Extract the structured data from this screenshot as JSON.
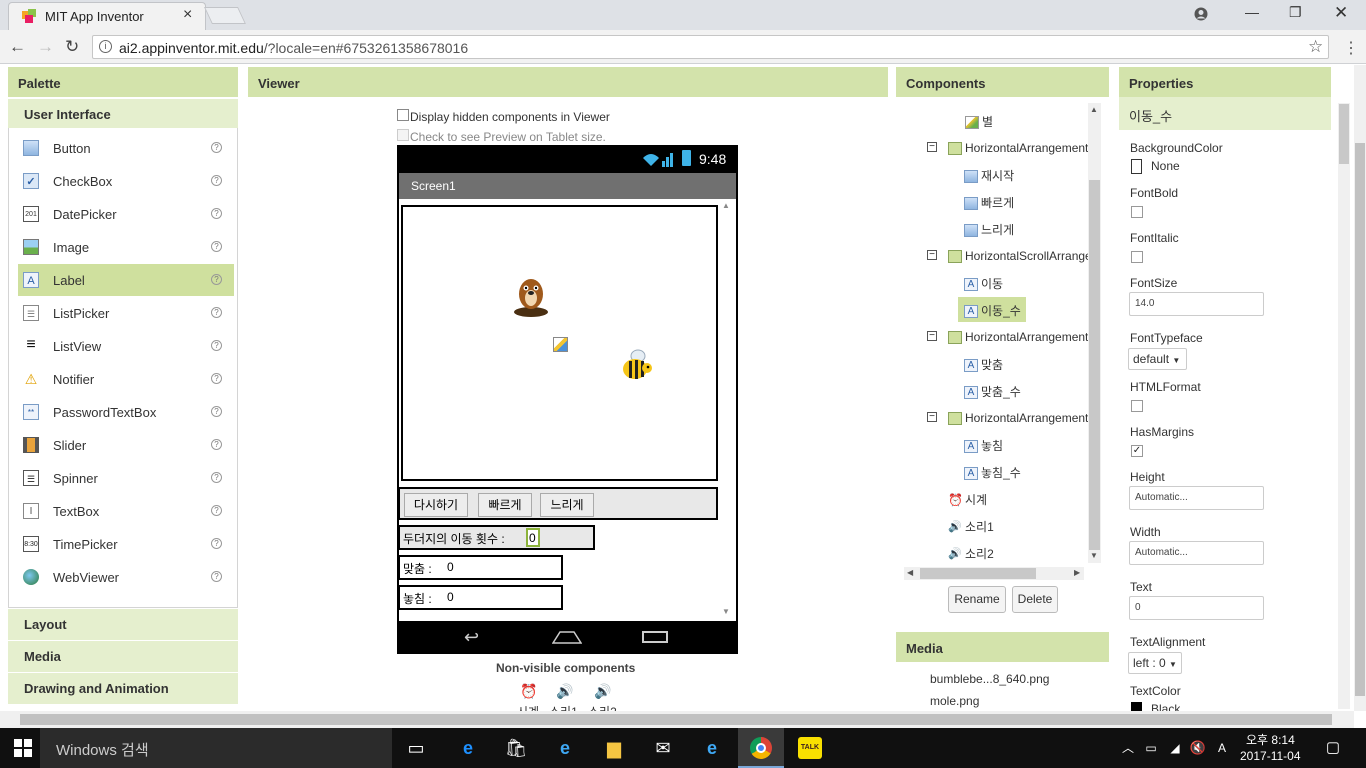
{
  "browser": {
    "tab_title": "MIT App Inventor",
    "url_host": "ai2.appinventor.mit.edu",
    "url_rest": "/?locale=en#6753261358678016"
  },
  "palette": {
    "title": "Palette",
    "active_category": "User Interface",
    "items": [
      "Button",
      "CheckBox",
      "DatePicker",
      "Image",
      "Label",
      "ListPicker",
      "ListView",
      "Notifier",
      "PasswordTextBox",
      "Slider",
      "Spinner",
      "TextBox",
      "TimePicker",
      "WebViewer"
    ],
    "selected": "Label",
    "other_categories": [
      "Layout",
      "Media",
      "Drawing and Animation"
    ]
  },
  "viewer": {
    "title": "Viewer",
    "display_hidden": "Display hidden components in Viewer",
    "tablet_preview": "Check to see Preview on Tablet size.",
    "time": "9:48",
    "screen_title": "Screen1",
    "buttons": [
      "다시하기",
      "빠르게",
      "느리게"
    ],
    "move_label": "두더지의 이동 횟수 :",
    "move_value": "0",
    "hit_label": "맞춤 :",
    "hit_value": "0",
    "miss_label": "놓침 :",
    "miss_value": "0",
    "nonvisible_title": "Non-visible components",
    "nonvisible": [
      "시계",
      "소리1",
      "소리2"
    ]
  },
  "components": {
    "title": "Components",
    "tree": [
      {
        "label": "별",
        "type": "sprite"
      },
      {
        "label": "HorizontalArrangement",
        "type": "arrangement",
        "toggle": "−"
      },
      {
        "label": "재시작",
        "type": "button"
      },
      {
        "label": "빠르게",
        "type": "button"
      },
      {
        "label": "느리게",
        "type": "button"
      },
      {
        "label": "HorizontalScrollArrangement",
        "type": "arrangement",
        "toggle": "−"
      },
      {
        "label": "이동",
        "type": "label"
      },
      {
        "label": "이동_수",
        "type": "label",
        "selected": true
      },
      {
        "label": "HorizontalArrangement",
        "type": "arrangement",
        "toggle": "−"
      },
      {
        "label": "맞춤",
        "type": "label"
      },
      {
        "label": "맞춤_수",
        "type": "label"
      },
      {
        "label": "HorizontalArrangement",
        "type": "arrangement",
        "toggle": "−"
      },
      {
        "label": "놓침",
        "type": "label"
      },
      {
        "label": "놓침_수",
        "type": "label"
      },
      {
        "label": "시계",
        "type": "clock"
      },
      {
        "label": "소리1",
        "type": "sound"
      },
      {
        "label": "소리2",
        "type": "sound"
      }
    ],
    "rename_label": "Rename",
    "delete_label": "Delete"
  },
  "media": {
    "title": "Media",
    "files": [
      "bumblebe...8_640.png",
      "mole.png"
    ]
  },
  "properties": {
    "title": "Properties",
    "component": "이동_수",
    "background_color_label": "BackgroundColor",
    "background_color_value": "None",
    "font_bold_label": "FontBold",
    "font_italic_label": "FontItalic",
    "font_size_label": "FontSize",
    "font_size_value": "14.0",
    "font_typeface_label": "FontTypeface",
    "font_typeface_value": "default",
    "html_format_label": "HTMLFormat",
    "has_margins_label": "HasMargins",
    "height_label": "Height",
    "height_value": "Automatic...",
    "width_label": "Width",
    "width_value": "Automatic...",
    "text_label": "Text",
    "text_value": "0",
    "text_alignment_label": "TextAlignment",
    "text_alignment_value": "left : 0",
    "text_color_label": "TextColor",
    "text_color_value": "Black",
    "has_margins_checked": true
  },
  "taskbar": {
    "search_placeholder": "Windows 검색",
    "time": "오후 8:14",
    "date": "2017-11-04"
  },
  "colors": {
    "header_green": "#d3e3ab",
    "selected_green": "#cfe09e"
  }
}
